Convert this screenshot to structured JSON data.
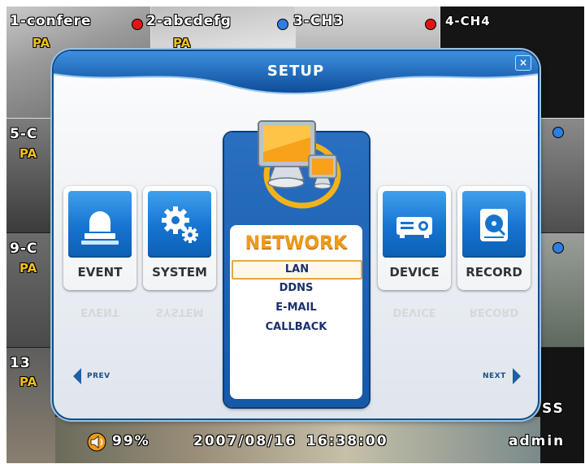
{
  "cameras": {
    "ch1": {
      "label": "1-confere",
      "sub": "PA"
    },
    "ch2": {
      "label": "2-abcdefg",
      "sub": "PA"
    },
    "ch3": {
      "label": "3-CH3"
    },
    "ch4": {
      "label": "4-CH4"
    },
    "ch5": {
      "label": "5-C",
      "sub": "PA"
    },
    "ch9": {
      "label": "9-C",
      "sub": "PA"
    },
    "ch13": {
      "label": "13",
      "sub": "PA"
    }
  },
  "status_bar": {
    "volume": "99%",
    "date": "2007/08/16",
    "time": "16:38:00",
    "user": "admin",
    "right_fragment": "SS"
  },
  "dialog": {
    "title": "SETUP",
    "close_glyph": "×",
    "tiles": [
      {
        "label": "EVENT",
        "icon": "siren-icon"
      },
      {
        "label": "SYSTEM",
        "icon": "gears-icon"
      },
      {
        "label": "DEVICE",
        "icon": "projector-icon"
      },
      {
        "label": "RECORD",
        "icon": "hard-disk-icon"
      }
    ],
    "network": {
      "title": "NETWORK",
      "icon": "computer-network-icon",
      "items": [
        "LAN",
        "DDNS",
        "E-MAIL",
        "CALLBACK"
      ],
      "selected": "LAN"
    },
    "prev_label": "PREV",
    "next_label": "NEXT"
  },
  "colors": {
    "accent_blue": "#1673cf",
    "network_orange": "#f09a18",
    "selection_border": "#e7a54a",
    "rec_dot": "#e01515",
    "live_dot": "#2f7de0"
  }
}
